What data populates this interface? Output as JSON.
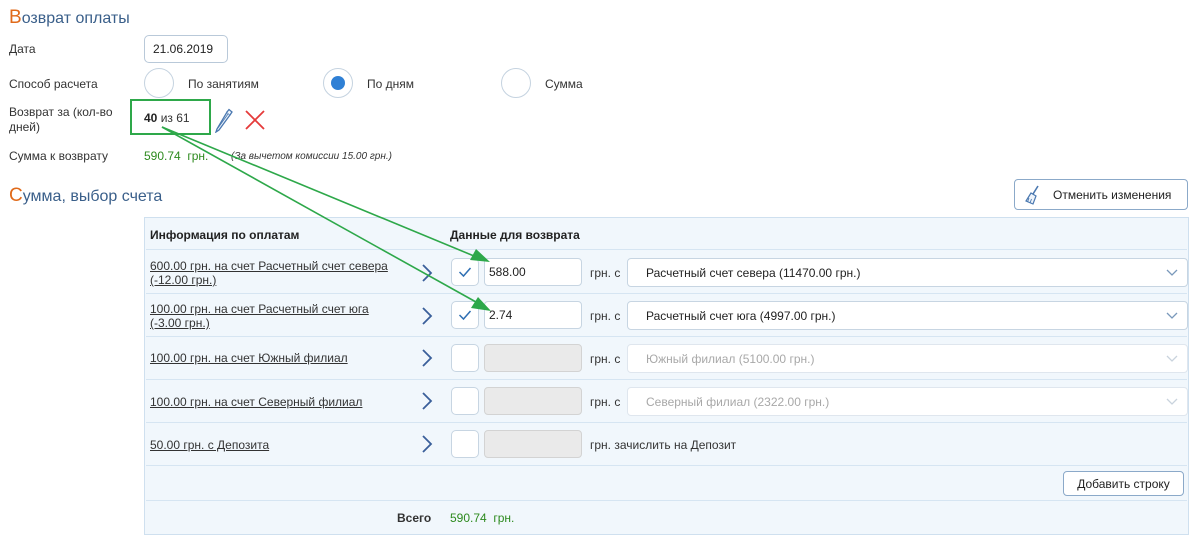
{
  "refund_section": {
    "title_first": "В",
    "title_rest": "озврат оплаты",
    "date_label": "Дата",
    "date_value": "21.06.2019",
    "method_label": "Способ расчета",
    "methods": [
      {
        "label": "По занятиям",
        "selected": false
      },
      {
        "label": "По дням",
        "selected": true
      },
      {
        "label": "Сумма",
        "selected": false
      }
    ],
    "refund_for_label": "Возврат за (кол-во дней)",
    "days_value": "40",
    "days_of": "из 61",
    "sum_label": "Сумма к возврату",
    "sum_value": "590.74",
    "sum_currency": "грн.",
    "commission_note": "(За вычетом комиссии 15.00 грн.)"
  },
  "account_section": {
    "title_first": "С",
    "title_rest": "умма, выбор счета",
    "cancel_button": "Отменить изменения",
    "col_payments": "Информация по оплатам",
    "col_refund": "Данные для возврата",
    "rows": [
      {
        "payment": "600.00 грн. на счет Расчетный счет севера (-12.00 грн.)",
        "checked": true,
        "amount": "588.00",
        "currency": "грн. с",
        "account": "Расчетный счет севера (11470.00 грн.)",
        "disabled": false
      },
      {
        "payment": "100.00 грн. на счет Расчетный счет юга (-3.00 грн.)",
        "checked": true,
        "amount": "2.74",
        "currency": "грн. с",
        "account": "Расчетный счет юга (4997.00 грн.)",
        "disabled": false
      },
      {
        "payment": "100.00 грн. на счет Южный филиал",
        "checked": false,
        "amount": "",
        "currency": "грн. с",
        "account": "Южный филиал (5100.00 грн.)",
        "disabled": true
      },
      {
        "payment": "100.00 грн. на счет Северный филиал",
        "checked": false,
        "amount": "",
        "currency": "грн. с",
        "account": "Северный филиал (2322.00 грн.)",
        "disabled": true
      },
      {
        "payment": "50.00 грн. с Депозита",
        "checked": false,
        "amount": "",
        "currency": "грн. зачислить на Депозит"
      }
    ],
    "add_row_button": "Добавить строку",
    "total_label": "Всего",
    "total_value": "590.74",
    "total_currency": "грн."
  },
  "colors": {
    "accent_orange": "#e06a1a",
    "title_blue": "#3a5f8a",
    "value_green": "#2d8a1e",
    "annotation_green": "#2ea84a",
    "radio_blue": "#2f80d5"
  }
}
